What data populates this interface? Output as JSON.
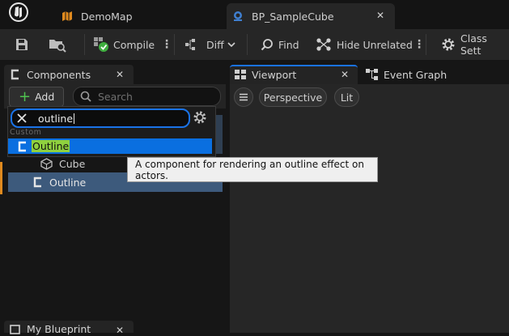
{
  "titlebar": {
    "tabs": [
      {
        "label": "DemoMap",
        "icon": "level-map-icon"
      },
      {
        "label": "BP_SampleCube",
        "icon": "blueprint-icon",
        "active": true
      }
    ]
  },
  "toolbar": {
    "compile_label": "Compile",
    "diff_label": "Diff",
    "find_label": "Find",
    "hide_unrelated_label": "Hide Unrelated",
    "class_settings_label": "Class Sett"
  },
  "components_panel": {
    "title": "Components",
    "add_label": "Add",
    "search_placeholder": "Search"
  },
  "add_dropdown": {
    "search_value": "outline",
    "category": "Custom",
    "result_label": "Outline",
    "highlight_color": "#8fd13f"
  },
  "component_tree": [
    {
      "label": "Cube",
      "icon": "static-mesh-icon"
    },
    {
      "label": "Outline",
      "icon": "component-class-icon"
    }
  ],
  "tooltip": {
    "text": "A component for rendering an outline effect on actors."
  },
  "viewport": {
    "tab_label": "Viewport",
    "event_graph_label": "Event Graph",
    "perspective_label": "Perspective",
    "lit_label": "Lit"
  },
  "my_blueprint": {
    "title": "My Blueprint"
  },
  "colors": {
    "selection_blue": "#0a6fe0",
    "row_selected": "#3d5a7c",
    "accent_orange": "#e08a1e",
    "blueprint_blue": "#3f7fd0"
  }
}
